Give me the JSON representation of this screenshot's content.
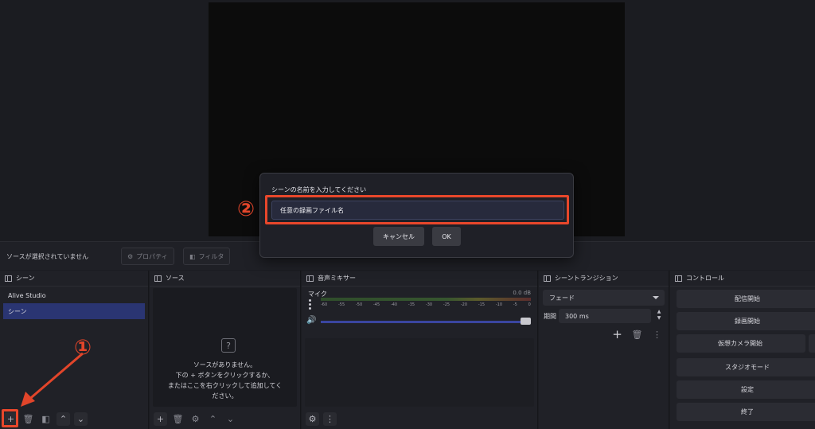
{
  "context_bar": {
    "no_source_text": "ソースが選択されていません",
    "properties_label": "プロパティ",
    "filters_label": "フィルタ"
  },
  "scenes": {
    "title": "シーン",
    "items": [
      {
        "label": "Alive Studio",
        "selected": false
      },
      {
        "label": "シーン",
        "selected": true
      }
    ]
  },
  "sources": {
    "title": "ソース",
    "empty_line1": "ソースがありません。",
    "empty_line2": "下の + ボタンをクリックするか、",
    "empty_line3": "またはここを右クリックして追加してく",
    "empty_line4": "ださい。"
  },
  "mixer": {
    "title": "音声ミキサー",
    "channel_name": "マイク",
    "level": "0.0 dB",
    "ticks": [
      "-60",
      "-55",
      "-50",
      "-45",
      "-40",
      "-35",
      "-30",
      "-25",
      "-20",
      "-15",
      "-10",
      "-5",
      "0"
    ]
  },
  "transitions": {
    "title": "シーントランジション",
    "selected": "フェード",
    "duration_label": "期間",
    "duration_value": "300 ms"
  },
  "controls": {
    "title": "コントロール",
    "buttons": [
      "配信開始",
      "録画開始",
      "仮想カメラ開始",
      "スタジオモード",
      "設定",
      "終了"
    ]
  },
  "dialog": {
    "title": "シーンの名前を入力してください",
    "input_value": "任意の録画ファイル名",
    "cancel_label": "キャンセル",
    "ok_label": "OK"
  },
  "annotations": {
    "marker1": "①",
    "marker2": "②",
    "color": "#e8472b"
  },
  "colors": {
    "selection": "#2a3572",
    "background": "#1b1c21"
  }
}
